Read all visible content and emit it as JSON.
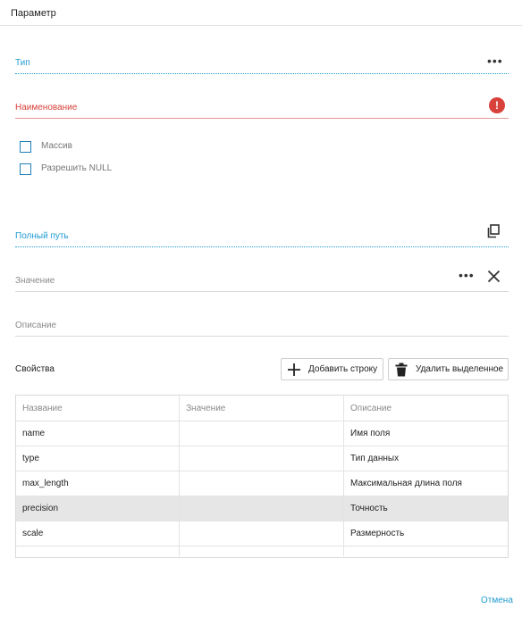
{
  "window": {
    "title": "Параметр"
  },
  "fields": {
    "type_label": "Тип",
    "name_label": "Наименование",
    "full_path_label": "Полный путь",
    "value_label": "Значение",
    "description_label": "Описание"
  },
  "checkboxes": [
    {
      "label": "Массив",
      "checked": false
    },
    {
      "label": "Разрешить NULL",
      "checked": false
    }
  ],
  "properties": {
    "label": "Свойства",
    "add_button": "Добавить строку",
    "delete_button": "Удалить выделенное",
    "columns": [
      "Название",
      "Значение",
      "Описание"
    ],
    "rows": [
      {
        "name": "name",
        "value": "",
        "description": "Имя поля",
        "selected": false
      },
      {
        "name": "type",
        "value": "",
        "description": "Тип данных",
        "selected": false
      },
      {
        "name": "max_length",
        "value": "",
        "description": "Максимальная длина поля",
        "selected": false
      },
      {
        "name": "precision",
        "value": "",
        "description": "Точность",
        "selected": true
      },
      {
        "name": "scale",
        "value": "",
        "description": "Размерность",
        "selected": false
      }
    ]
  },
  "footer": {
    "cancel": "Отмена"
  },
  "colors": {
    "accent": "#1f9bd1",
    "error": "#d9413b",
    "selected_row": "#e6e6e6"
  },
  "icons": [
    "more-icon",
    "error-icon",
    "copy-icon",
    "close-icon",
    "plus-icon",
    "trash-icon"
  ]
}
